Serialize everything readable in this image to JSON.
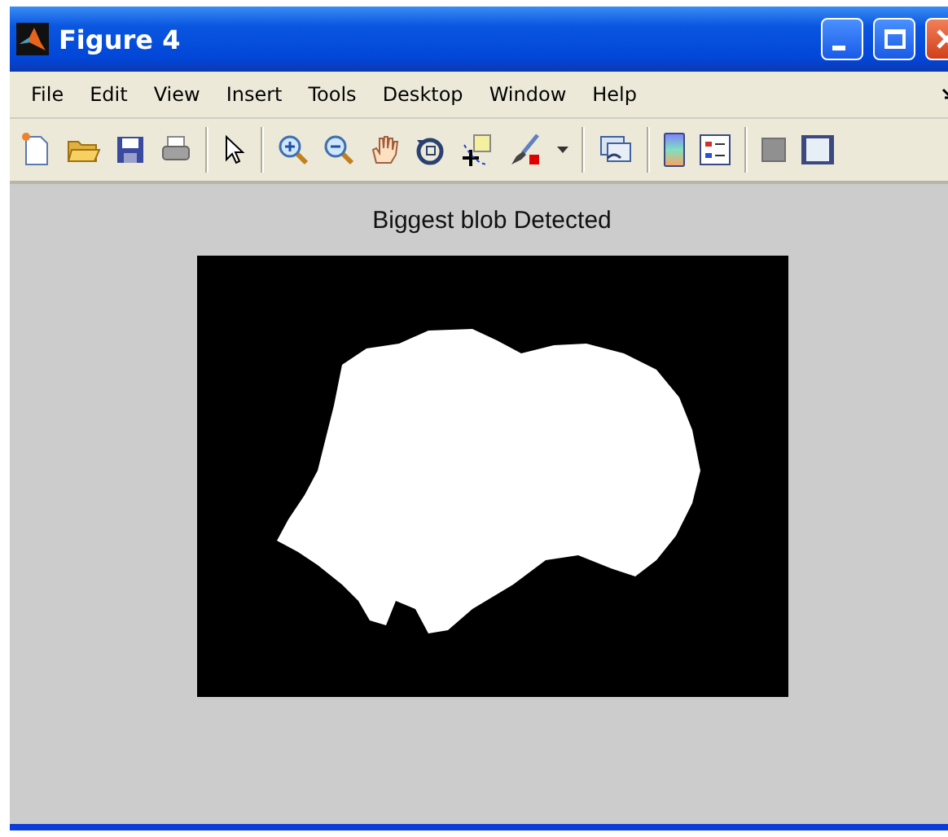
{
  "window": {
    "title": "Figure 4"
  },
  "menu": [
    "File",
    "Edit",
    "View",
    "Insert",
    "Tools",
    "Desktop",
    "Window",
    "Help"
  ],
  "axes": {
    "title": "Biggest blob Detected"
  }
}
